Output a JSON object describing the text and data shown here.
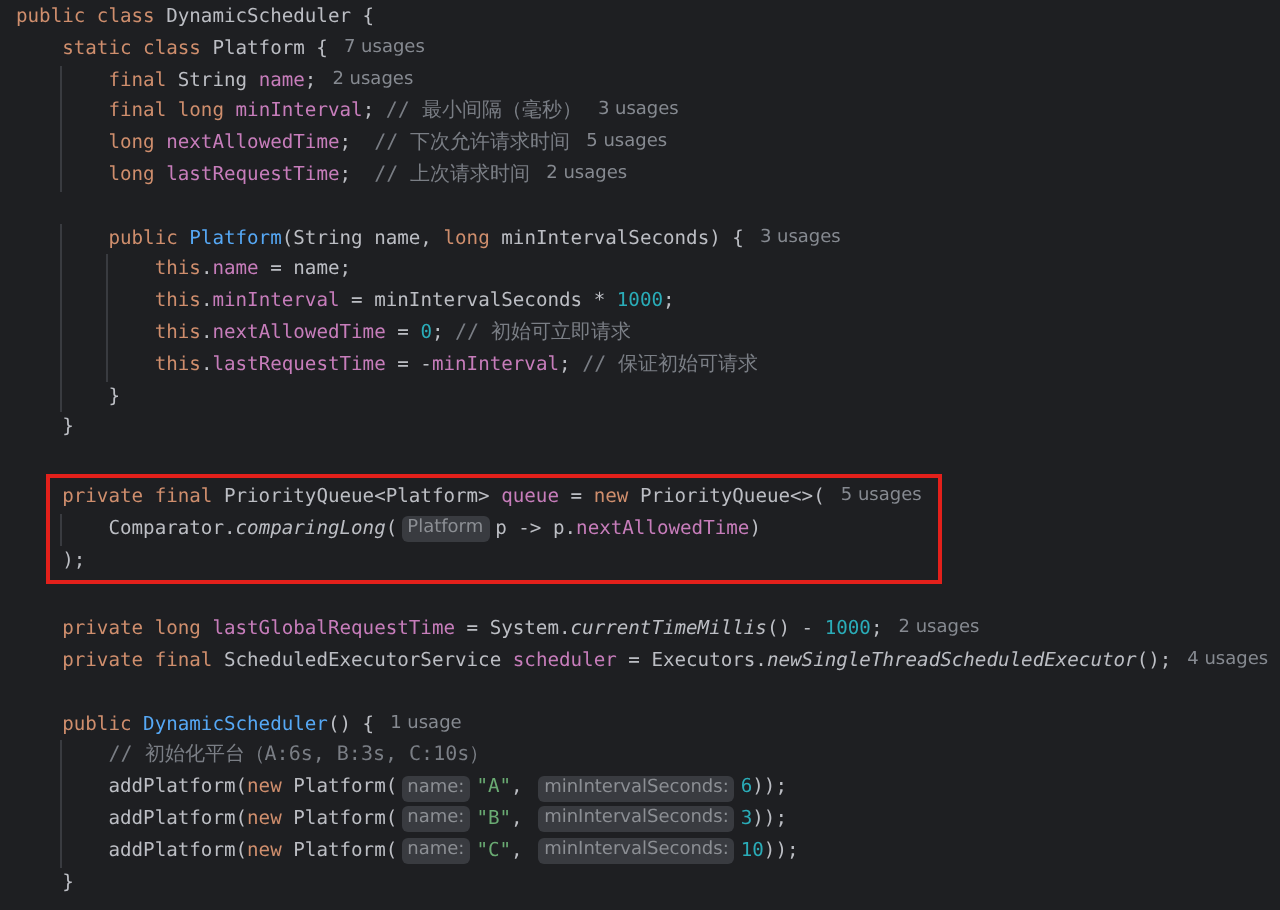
{
  "sections": [
    {
      "boxed": false,
      "lines": [
        {
          "kind": "code",
          "tokens": [
            {
              "kind": "keyword",
              "text": "public class "
            },
            {
              "kind": "plain",
              "text": "DynamicScheduler {"
            }
          ]
        },
        {
          "kind": "code",
          "tokens": [
            {
              "kind": "keyword",
              "text": "    static class "
            },
            {
              "kind": "plain",
              "text": "Platform {"
            },
            {
              "kind": "usage",
              "text": "7 usages"
            }
          ]
        },
        {
          "kind": "code",
          "tokens": [
            {
              "kind": "keyword",
              "text": "        final "
            },
            {
              "kind": "plain",
              "text": "String "
            },
            {
              "kind": "field",
              "text": "name"
            },
            {
              "kind": "plain",
              "text": ";"
            },
            {
              "kind": "usage",
              "text": "2 usages"
            }
          ]
        },
        {
          "kind": "code",
          "tokens": [
            {
              "kind": "keyword",
              "text": "        final long "
            },
            {
              "kind": "field",
              "text": "minInterval"
            },
            {
              "kind": "plain",
              "text": "; "
            },
            {
              "kind": "comment",
              "text": "// 最小间隔（毫秒）"
            },
            {
              "kind": "usage",
              "text": "3 usages"
            }
          ]
        },
        {
          "kind": "code",
          "tokens": [
            {
              "kind": "keyword",
              "text": "        long "
            },
            {
              "kind": "field",
              "text": "nextAllowedTime"
            },
            {
              "kind": "plain",
              "text": ";  "
            },
            {
              "kind": "comment",
              "text": "// 下次允许请求时间"
            },
            {
              "kind": "usage",
              "text": "5 usages"
            }
          ]
        },
        {
          "kind": "code",
          "tokens": [
            {
              "kind": "keyword",
              "text": "        long "
            },
            {
              "kind": "field",
              "text": "lastRequestTime"
            },
            {
              "kind": "plain",
              "text": ";  "
            },
            {
              "kind": "comment",
              "text": "// 上次请求时间"
            },
            {
              "kind": "usage",
              "text": "2 usages"
            }
          ]
        },
        {
          "kind": "blank"
        },
        {
          "kind": "code",
          "tokens": [
            {
              "kind": "keyword",
              "text": "        public "
            },
            {
              "kind": "declaration",
              "text": "Platform"
            },
            {
              "kind": "plain",
              "text": "(String name, "
            },
            {
              "kind": "keyword",
              "text": "long "
            },
            {
              "kind": "plain",
              "text": "minIntervalSeconds) {"
            },
            {
              "kind": "usage",
              "text": "3 usages"
            }
          ]
        },
        {
          "kind": "code",
          "tokens": [
            {
              "kind": "keyword",
              "text": "            this"
            },
            {
              "kind": "plain",
              "text": "."
            },
            {
              "kind": "field",
              "text": "name"
            },
            {
              "kind": "plain",
              "text": " = name;"
            }
          ]
        },
        {
          "kind": "code",
          "tokens": [
            {
              "kind": "keyword",
              "text": "            this"
            },
            {
              "kind": "plain",
              "text": "."
            },
            {
              "kind": "field",
              "text": "minInterval"
            },
            {
              "kind": "plain",
              "text": " = minIntervalSeconds * "
            },
            {
              "kind": "number",
              "text": "1000"
            },
            {
              "kind": "plain",
              "text": ";"
            }
          ]
        },
        {
          "kind": "code",
          "tokens": [
            {
              "kind": "keyword",
              "text": "            this"
            },
            {
              "kind": "plain",
              "text": "."
            },
            {
              "kind": "field",
              "text": "nextAllowedTime"
            },
            {
              "kind": "plain",
              "text": " = "
            },
            {
              "kind": "number",
              "text": "0"
            },
            {
              "kind": "plain",
              "text": "; "
            },
            {
              "kind": "comment",
              "text": "// 初始可立即请求"
            }
          ]
        },
        {
          "kind": "code",
          "tokens": [
            {
              "kind": "keyword",
              "text": "            this"
            },
            {
              "kind": "plain",
              "text": "."
            },
            {
              "kind": "field",
              "text": "lastRequestTime"
            },
            {
              "kind": "plain",
              "text": " = -"
            },
            {
              "kind": "field",
              "text": "minInterval"
            },
            {
              "kind": "plain",
              "text": "; "
            },
            {
              "kind": "comment",
              "text": "// 保证初始可请求"
            }
          ]
        },
        {
          "kind": "code",
          "tokens": [
            {
              "kind": "plain",
              "text": "        }"
            }
          ]
        },
        {
          "kind": "code",
          "tokens": [
            {
              "kind": "plain",
              "text": "    }"
            }
          ]
        },
        {
          "kind": "blank"
        }
      ]
    },
    {
      "boxed": true,
      "lines": [
        {
          "kind": "code",
          "tokens": [
            {
              "kind": "keyword",
              "text": "    private final "
            },
            {
              "kind": "plain",
              "text": "PriorityQueue<Platform> "
            },
            {
              "kind": "field",
              "text": "queue"
            },
            {
              "kind": "plain",
              "text": " = "
            },
            {
              "kind": "keyword",
              "text": "new "
            },
            {
              "kind": "plain",
              "text": "PriorityQueue<>("
            },
            {
              "kind": "usage",
              "text": "5 usages"
            }
          ]
        },
        {
          "kind": "code",
          "tokens": [
            {
              "kind": "plain",
              "text": "        Comparator."
            },
            {
              "kind": "static_call",
              "text": "comparingLong"
            },
            {
              "kind": "plain",
              "text": "("
            },
            {
              "kind": "hint",
              "text": "Platform"
            },
            {
              "kind": "plain",
              "text": "p -> p."
            },
            {
              "kind": "field",
              "text": "nextAllowedTime"
            },
            {
              "kind": "plain",
              "text": ")"
            }
          ]
        },
        {
          "kind": "code",
          "tokens": [
            {
              "kind": "plain",
              "text": "    );"
            }
          ]
        }
      ]
    },
    {
      "boxed": false,
      "lines": [
        {
          "kind": "blank"
        },
        {
          "kind": "code",
          "tokens": [
            {
              "kind": "keyword",
              "text": "    private long "
            },
            {
              "kind": "field",
              "text": "lastGlobalRequestTime"
            },
            {
              "kind": "plain",
              "text": " = System."
            },
            {
              "kind": "static_call",
              "text": "currentTimeMillis"
            },
            {
              "kind": "plain",
              "text": "() - "
            },
            {
              "kind": "number",
              "text": "1000"
            },
            {
              "kind": "plain",
              "text": ";"
            },
            {
              "kind": "usage",
              "text": "2 usages"
            }
          ]
        },
        {
          "kind": "code",
          "tokens": [
            {
              "kind": "keyword",
              "text": "    private final "
            },
            {
              "kind": "plain",
              "text": "ScheduledExecutorService "
            },
            {
              "kind": "field",
              "text": "scheduler"
            },
            {
              "kind": "plain",
              "text": " = Executors."
            },
            {
              "kind": "static_call",
              "text": "newSingleThreadScheduledExecutor"
            },
            {
              "kind": "plain",
              "text": "();"
            },
            {
              "kind": "usage",
              "text": "4 usages"
            }
          ]
        },
        {
          "kind": "blank"
        },
        {
          "kind": "code",
          "tokens": [
            {
              "kind": "keyword",
              "text": "    public "
            },
            {
              "kind": "declaration",
              "text": "DynamicScheduler"
            },
            {
              "kind": "plain",
              "text": "() {"
            },
            {
              "kind": "usage",
              "text": "1 usage"
            }
          ]
        },
        {
          "kind": "code",
          "tokens": [
            {
              "kind": "comment",
              "text": "        // 初始化平台（A:6s, B:3s, C:10s）"
            }
          ]
        },
        {
          "kind": "code",
          "tokens": [
            {
              "kind": "plain",
              "text": "        addPlatform("
            },
            {
              "kind": "keyword",
              "text": "new "
            },
            {
              "kind": "plain",
              "text": "Platform("
            },
            {
              "kind": "hint",
              "text": "name:"
            },
            {
              "kind": "string",
              "text": "\"A\""
            },
            {
              "kind": "plain",
              "text": ", "
            },
            {
              "kind": "hint",
              "text": "minIntervalSeconds:"
            },
            {
              "kind": "number",
              "text": "6"
            },
            {
              "kind": "plain",
              "text": "));"
            }
          ]
        },
        {
          "kind": "code",
          "tokens": [
            {
              "kind": "plain",
              "text": "        addPlatform("
            },
            {
              "kind": "keyword",
              "text": "new "
            },
            {
              "kind": "plain",
              "text": "Platform("
            },
            {
              "kind": "hint",
              "text": "name:"
            },
            {
              "kind": "string",
              "text": "\"B\""
            },
            {
              "kind": "plain",
              "text": ", "
            },
            {
              "kind": "hint",
              "text": "minIntervalSeconds:"
            },
            {
              "kind": "number",
              "text": "3"
            },
            {
              "kind": "plain",
              "text": "));"
            }
          ]
        },
        {
          "kind": "code",
          "tokens": [
            {
              "kind": "plain",
              "text": "        addPlatform("
            },
            {
              "kind": "keyword",
              "text": "new "
            },
            {
              "kind": "plain",
              "text": "Platform("
            },
            {
              "kind": "hint",
              "text": "name:"
            },
            {
              "kind": "string",
              "text": "\"C\""
            },
            {
              "kind": "plain",
              "text": ", "
            },
            {
              "kind": "hint",
              "text": "minIntervalSeconds:"
            },
            {
              "kind": "number",
              "text": "10"
            },
            {
              "kind": "plain",
              "text": "));"
            }
          ]
        },
        {
          "kind": "code",
          "tokens": [
            {
              "kind": "plain",
              "text": "    }"
            }
          ]
        }
      ]
    }
  ]
}
